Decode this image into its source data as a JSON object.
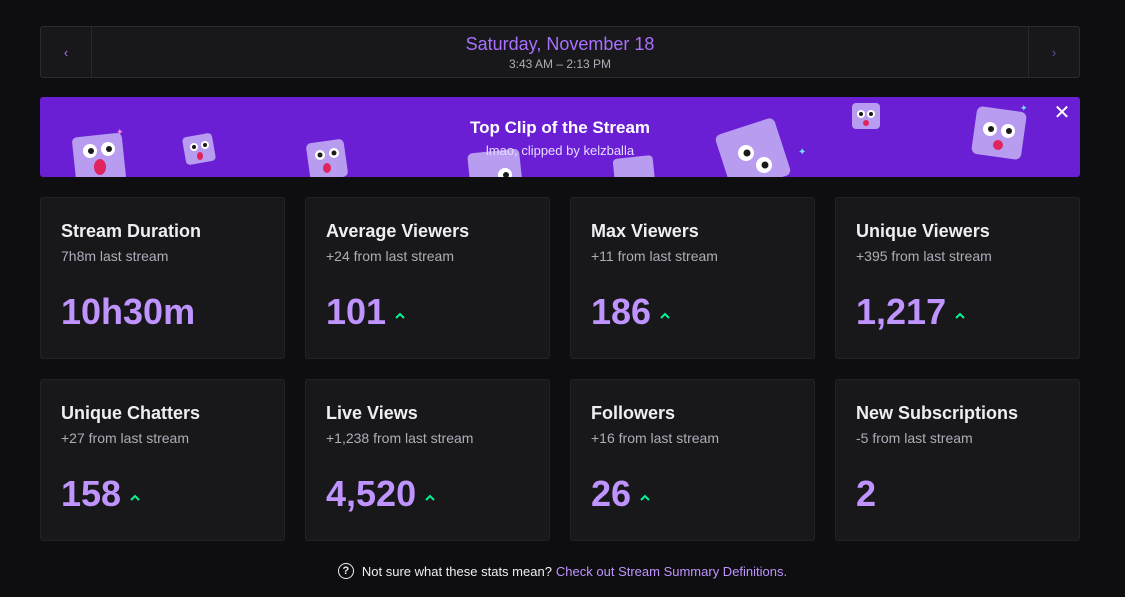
{
  "date_nav": {
    "date": "Saturday, November 18",
    "time_range": "3:43 AM – 2:13 PM",
    "prev_glyph": "‹",
    "next_glyph": "›"
  },
  "banner": {
    "title": "Top Clip of the Stream",
    "subtitle": "lmao, clipped by kelzballa",
    "close_glyph": "✕",
    "background": "#6b1fd4"
  },
  "stats": [
    {
      "title": "Stream Duration",
      "sub": "7h8m last stream",
      "value": "10h30m",
      "trend": "none"
    },
    {
      "title": "Average Viewers",
      "sub": "+24 from last stream",
      "value": "101",
      "trend": "up"
    },
    {
      "title": "Max Viewers",
      "sub": "+11 from last stream",
      "value": "186",
      "trend": "up"
    },
    {
      "title": "Unique Viewers",
      "sub": "+395 from last stream",
      "value": "1,217",
      "trend": "up"
    },
    {
      "title": "Unique Chatters",
      "sub": "+27 from last stream",
      "value": "158",
      "trend": "up"
    },
    {
      "title": "Live Views",
      "sub": "+1,238 from last stream",
      "value": "4,520",
      "trend": "up"
    },
    {
      "title": "Followers",
      "sub": "+16 from last stream",
      "value": "26",
      "trend": "up"
    },
    {
      "title": "New Subscriptions",
      "sub": "-5 from last stream",
      "value": "2",
      "trend": "none"
    }
  ],
  "footer": {
    "text": "Not sure what these stats mean?",
    "link": "Check out Stream Summary Definitions."
  },
  "colors": {
    "accent": "#bf94ff",
    "trend_up": "#00f593",
    "background": "#0e0e10",
    "card": "#18181b"
  }
}
